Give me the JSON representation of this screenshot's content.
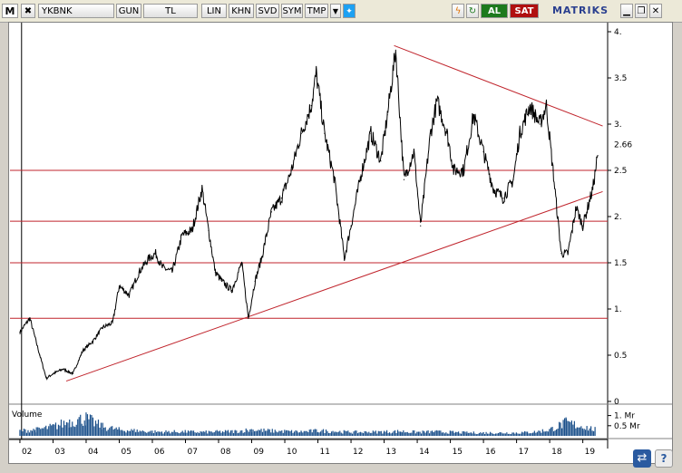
{
  "toolbar": {
    "logo": "M",
    "symbol": "YKBNK",
    "buttons": [
      "GUN",
      "TL",
      "LIN",
      "KHN",
      "SVD",
      "SYM",
      "TMP"
    ],
    "buy_label": "AL",
    "sell_label": "SAT",
    "brand": "MATRIKS",
    "icons": [
      "close-icon",
      "dropdown-arrow-icon",
      "twitter-bird-icon",
      "lightning-icon",
      "refresh-icon",
      "minimize-icon",
      "restore-icon",
      "close-window-icon"
    ]
  },
  "colors": {
    "price_line": "#000000",
    "support_lines": "#c0242c",
    "volume_bars": "#1a4f8a",
    "al": "#1d7a1d",
    "sat": "#b01010"
  },
  "chart_data": {
    "type": "line",
    "ylim": [
      0,
      4
    ],
    "y_ticks": [
      "0",
      "0.5",
      "1.",
      "1.5",
      "2.",
      "2.5",
      "3.",
      "3.5",
      "4."
    ],
    "y_tick_values": [
      0,
      0.5,
      1,
      1.5,
      2,
      2.5,
      3,
      3.5,
      4
    ],
    "x_ticks": [
      "02",
      "03",
      "04",
      "05",
      "06",
      "07",
      "08",
      "09",
      "10",
      "11",
      "12",
      "13",
      "14",
      "15",
      "16",
      "17",
      "18",
      "19"
    ],
    "last_value_label": "2.66",
    "series": [
      {
        "x": [
          2002.0,
          2002.3,
          2002.6,
          2002.8,
          2003.0,
          2003.3,
          2003.6,
          2003.9,
          2004.2,
          2004.5,
          2004.8,
          2005.0,
          2005.3,
          2005.6,
          2005.9,
          2006.1,
          2006.3,
          2006.6,
          2006.9,
          2007.2,
          2007.5,
          2007.7,
          2007.9,
          2008.1,
          2008.4,
          2008.7,
          2008.9,
          2009.1,
          2009.3,
          2009.6,
          2009.9,
          2010.2,
          2010.5,
          2010.8,
          2010.95,
          2011.2,
          2011.5,
          2011.8,
          2012.0,
          2012.3,
          2012.6,
          2012.9,
          2013.1,
          2013.35,
          2013.6,
          2013.9,
          2014.1,
          2014.4,
          2014.6,
          2014.9,
          2015.1,
          2015.4,
          2015.7,
          2016.0,
          2016.3,
          2016.6,
          2016.9,
          2017.1,
          2017.4,
          2017.7,
          2017.9,
          2018.1,
          2018.35,
          2018.55,
          2018.8,
          2019.0,
          2019.3,
          2019.45
        ],
        "values": [
          0.75,
          0.9,
          0.5,
          0.25,
          0.3,
          0.35,
          0.3,
          0.55,
          0.65,
          0.8,
          0.85,
          1.25,
          1.15,
          1.4,
          1.55,
          1.6,
          1.45,
          1.4,
          1.8,
          1.85,
          2.3,
          1.85,
          1.4,
          1.3,
          1.2,
          1.5,
          0.9,
          1.3,
          1.55,
          2.05,
          2.2,
          2.5,
          2.9,
          3.2,
          3.55,
          2.9,
          2.4,
          1.55,
          1.9,
          2.45,
          2.9,
          2.6,
          3.1,
          3.8,
          2.4,
          2.7,
          1.9,
          2.9,
          3.25,
          2.9,
          2.5,
          2.5,
          3.1,
          2.7,
          2.3,
          2.2,
          2.4,
          2.9,
          3.2,
          3.0,
          3.2,
          2.5,
          1.6,
          1.6,
          2.1,
          1.9,
          2.3,
          2.66
        ]
      }
    ],
    "horizontal_lines": [
      0.9,
      1.5,
      1.95,
      2.5
    ],
    "trendlines": [
      {
        "x": [
          2003.4,
          2019.6
        ],
        "values": [
          0.22,
          2.27
        ]
      },
      {
        "x": [
          2013.3,
          2019.6
        ],
        "values": [
          3.85,
          2.98
        ]
      }
    ],
    "volume": {
      "label": "Volume",
      "y_ticks": [
        "1. Mr",
        "0.5 Mr"
      ],
      "y_tick_values": [
        1.0,
        0.5
      ],
      "ylim": [
        0,
        1.25
      ],
      "x": [
        2002.0,
        2002.5,
        2003.0,
        2003.5,
        2004.0,
        2004.5,
        2005.0,
        2005.5,
        2006.0,
        2006.5,
        2007.0,
        2007.5,
        2008.0,
        2008.5,
        2009.0,
        2009.5,
        2010.0,
        2010.5,
        2011.0,
        2011.5,
        2012.0,
        2012.5,
        2013.0,
        2013.5,
        2014.0,
        2014.5,
        2015.0,
        2015.5,
        2016.0,
        2016.5,
        2017.0,
        2017.5,
        2018.0,
        2018.5,
        2019.0,
        2019.4
      ],
      "values": [
        0.25,
        0.3,
        0.45,
        0.7,
        0.85,
        0.45,
        0.3,
        0.25,
        0.2,
        0.2,
        0.2,
        0.18,
        0.2,
        0.22,
        0.3,
        0.25,
        0.22,
        0.2,
        0.25,
        0.22,
        0.18,
        0.18,
        0.2,
        0.22,
        0.18,
        0.2,
        0.18,
        0.15,
        0.15,
        0.15,
        0.15,
        0.18,
        0.3,
        0.65,
        0.45,
        0.3
      ]
    }
  }
}
